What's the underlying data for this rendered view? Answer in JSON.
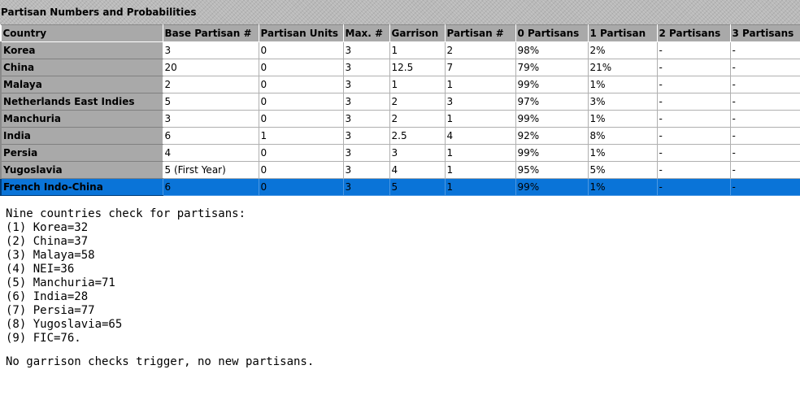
{
  "title": "Partisan Numbers and Probabilities",
  "columns": [
    "Country",
    "Base Partisan #",
    "Partisan Units",
    "Max. #",
    "Garrison",
    "Partisan #",
    "0 Partisans",
    "1 Partisan",
    "2 Partisans",
    "3 Partisans"
  ],
  "rows": [
    {
      "country": "Korea",
      "base": "3",
      "units": "0",
      "max": "3",
      "garrison": "1",
      "partisan_num": "2",
      "p0": "98%",
      "p1": "2%",
      "p2": "-",
      "p3": "-"
    },
    {
      "country": "China",
      "base": "20",
      "units": "0",
      "max": "3",
      "garrison": "12.5",
      "partisan_num": "7",
      "p0": "79%",
      "p1": "21%",
      "p2": "-",
      "p3": "-"
    },
    {
      "country": "Malaya",
      "base": "2",
      "units": "0",
      "max": "3",
      "garrison": "1",
      "partisan_num": "1",
      "p0": "99%",
      "p1": "1%",
      "p2": "-",
      "p3": "-"
    },
    {
      "country": "Netherlands East Indies",
      "base": "5",
      "units": "0",
      "max": "3",
      "garrison": "2",
      "partisan_num": "3",
      "p0": "97%",
      "p1": "3%",
      "p2": "-",
      "p3": "-"
    },
    {
      "country": "Manchuria",
      "base": "3",
      "units": "0",
      "max": "3",
      "garrison": "2",
      "partisan_num": "1",
      "p0": "99%",
      "p1": "1%",
      "p2": "-",
      "p3": "-"
    },
    {
      "country": "India",
      "base": "6",
      "units": "1",
      "max": "3",
      "garrison": "2.5",
      "partisan_num": "4",
      "p0": "92%",
      "p1": "8%",
      "p2": "-",
      "p3": "-"
    },
    {
      "country": "Persia",
      "base": "4",
      "units": "0",
      "max": "3",
      "garrison": "3",
      "partisan_num": "1",
      "p0": "99%",
      "p1": "1%",
      "p2": "-",
      "p3": "-"
    },
    {
      "country": "Yugoslavia",
      "base": "5 (First Year)",
      "units": "0",
      "max": "3",
      "garrison": "4",
      "partisan_num": "1",
      "p0": "95%",
      "p1": "5%",
      "p2": "-",
      "p3": "-"
    },
    {
      "country": "French Indo-China",
      "base": "6",
      "units": "0",
      "max": "3",
      "garrison": "5",
      "partisan_num": "1",
      "p0": "99%",
      "p1": "1%",
      "p2": "-",
      "p3": "-",
      "selected": true
    }
  ],
  "notes": {
    "intro": "Nine countries check for partisans:",
    "checks": [
      "(1) Korea=32",
      "(2) China=37",
      "(3) Malaya=58",
      "(4) NEI=36",
      "(5) Manchuria=71",
      "(6) India=28",
      "(7) Persia=77",
      "(8) Yugoslavia=65",
      "(9) FIC=76."
    ],
    "conclusion": "No garrison checks trigger, no new partisans."
  },
  "colors": {
    "header_bg": "#a9a9a9",
    "selected_row_bg": "#0a74d8",
    "title_bg": "#b9b9b9"
  }
}
